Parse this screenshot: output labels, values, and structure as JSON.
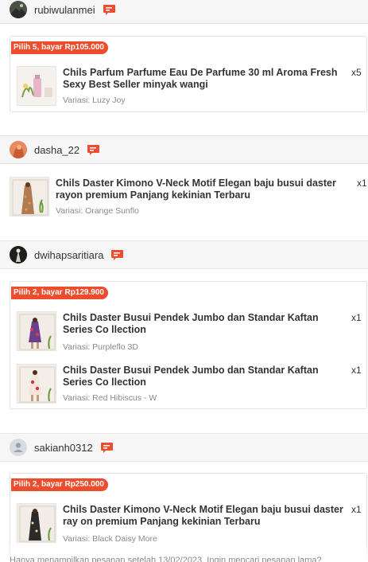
{
  "orders": [
    {
      "seller": "rubiwulanmei",
      "promo": "Pilih 5, bayar Rp105.000",
      "items": [
        {
          "title": "Chils Parfum Parfume Eau De Parfume 30 ml Aroma Fresh Sexy Best Seller minyak wangi",
          "variant": "Variasi: Luzy Joy",
          "qty": "x5"
        }
      ]
    },
    {
      "seller": "dasha_22",
      "promo": "",
      "items": [
        {
          "title": "Chils Daster Kimono V-Neck Motif Elegan baju busui daster rayon premium Panjang kekinian Terbaru",
          "variant": "Variasi: Orange Sunflo",
          "qty": "x1"
        }
      ]
    },
    {
      "seller": "dwihapsaritiara",
      "promo": "Pilih 2, bayar Rp129.900",
      "items": [
        {
          "title": "Chils Daster Busui Pendek Jumbo dan Standar Kaftan Series Co llection",
          "variant": "Variasi: Purpleflo 3D",
          "qty": "x1"
        },
        {
          "title": "Chils Daster Busui Pendek Jumbo dan Standar Kaftan Series Co llection",
          "variant": "Variasi: Red Hibiscus - W",
          "qty": "x1"
        }
      ]
    },
    {
      "seller": "sakianh0312",
      "promo": "Pilih 2, bayar Rp250.000",
      "items": [
        {
          "title": "Chils Daster Kimono V-Neck Motif Elegan baju busui daster ray on premium Panjang kekinian Terbaru",
          "variant": "Variasi: Black Daisy More",
          "qty": "x1"
        }
      ]
    }
  ],
  "footer": {
    "text": "Hanya menampilkan pesanan setelah 13/02/2023. Ingin mencari pesanan lama?"
  },
  "colors": {
    "accent": "#ee4d2d",
    "bar_bg": "#f6f6f6",
    "muted": "#8a8a8a"
  },
  "icons": [
    "chat-icon",
    "default-avatar-icon"
  ]
}
